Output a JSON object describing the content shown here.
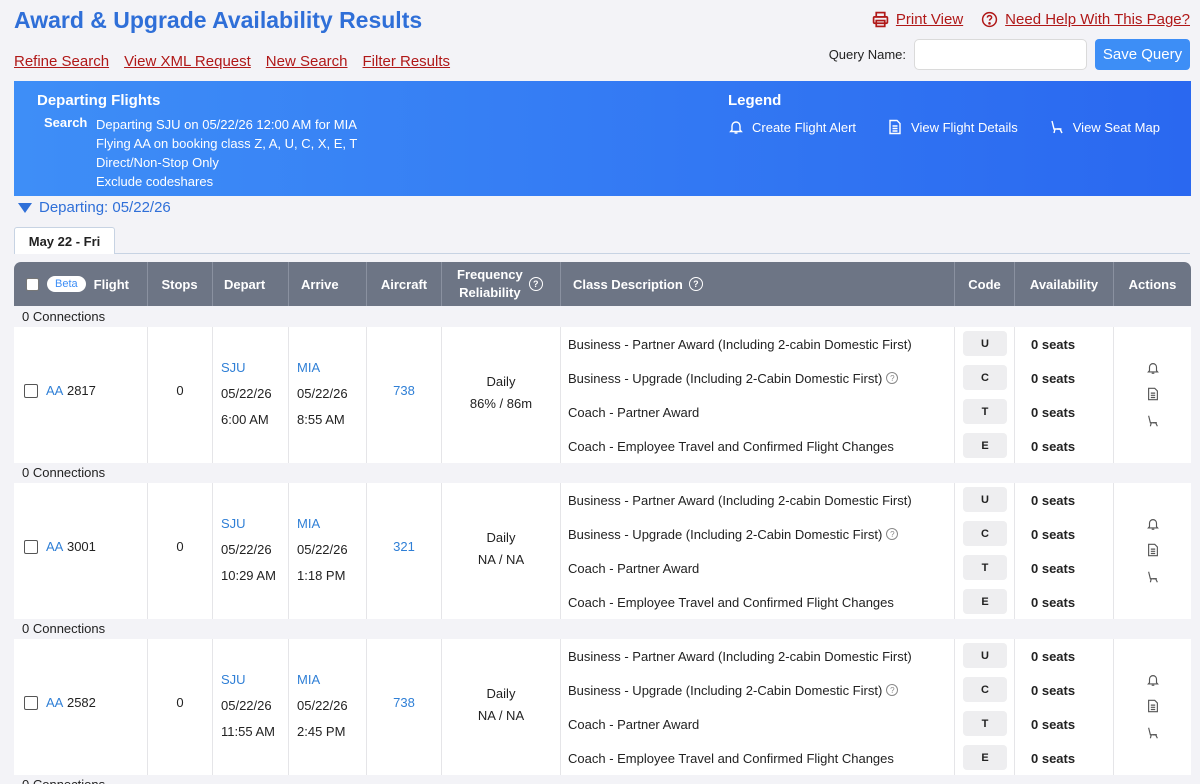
{
  "header": {
    "title": "Award & Upgrade Availability Results",
    "print_label": "Print View",
    "help_label": "Need Help With This Page?"
  },
  "nav": [
    "Refine Search",
    "View XML Request",
    "New Search",
    "Filter Results"
  ],
  "query": {
    "label": "Query Name:",
    "value": "",
    "save_label": "Save Query"
  },
  "banner": {
    "title": "Departing Flights",
    "search_label": "Search",
    "search_lines": [
      "Departing SJU on 05/22/26 12:00 AM for MIA",
      "Flying AA on booking class Z, A, U, C, X, E, T",
      "Direct/Non-Stop Only",
      "Exclude codeshares"
    ],
    "legend_title": "Legend",
    "legend": [
      "Create Flight Alert",
      "View Flight Details",
      "View Seat Map"
    ]
  },
  "departing_label": "Departing: 05/22/26",
  "tab_label": "May 22 - Fri",
  "columns": {
    "beta": "Beta",
    "flight": "Flight",
    "stops": "Stops",
    "depart": "Depart",
    "arrive": "Arrive",
    "aircraft": "Aircraft",
    "freq1": "Frequency",
    "freq2": "Reliability",
    "class_desc": "Class Description",
    "code": "Code",
    "availability": "Availability",
    "actions": "Actions"
  },
  "connections_label": "0 Connections",
  "flights": [
    {
      "carrier": "AA",
      "number": "2817",
      "stops": "0",
      "dep_airport": "SJU",
      "dep_date": "05/22/26",
      "dep_time": "6:00 AM",
      "arr_airport": "MIA",
      "arr_date": "05/22/26",
      "arr_time": "8:55 AM",
      "aircraft": "738",
      "frequency": "Daily",
      "reliability": "86% / 86m",
      "classes": [
        {
          "desc": "Business - Partner Award (Including 2-cabin Domestic First)",
          "help": false,
          "code": "U",
          "avail": "0 seats"
        },
        {
          "desc": "Business - Upgrade (Including 2-Cabin Domestic First)",
          "help": true,
          "code": "C",
          "avail": "0 seats"
        },
        {
          "desc": "Coach - Partner Award",
          "help": false,
          "code": "T",
          "avail": "0 seats"
        },
        {
          "desc": "Coach - Employee Travel and Confirmed Flight Changes",
          "help": false,
          "code": "E",
          "avail": "0 seats"
        }
      ]
    },
    {
      "carrier": "AA",
      "number": "3001",
      "stops": "0",
      "dep_airport": "SJU",
      "dep_date": "05/22/26",
      "dep_time": "10:29 AM",
      "arr_airport": "MIA",
      "arr_date": "05/22/26",
      "arr_time": "1:18 PM",
      "aircraft": "321",
      "frequency": "Daily",
      "reliability": "NA / NA",
      "classes": [
        {
          "desc": "Business - Partner Award (Including 2-cabin Domestic First)",
          "help": false,
          "code": "U",
          "avail": "0 seats"
        },
        {
          "desc": "Business - Upgrade (Including 2-Cabin Domestic First)",
          "help": true,
          "code": "C",
          "avail": "0 seats"
        },
        {
          "desc": "Coach - Partner Award",
          "help": false,
          "code": "T",
          "avail": "0 seats"
        },
        {
          "desc": "Coach - Employee Travel and Confirmed Flight Changes",
          "help": false,
          "code": "E",
          "avail": "0 seats"
        }
      ]
    },
    {
      "carrier": "AA",
      "number": "2582",
      "stops": "0",
      "dep_airport": "SJU",
      "dep_date": "05/22/26",
      "dep_time": "11:55 AM",
      "arr_airport": "MIA",
      "arr_date": "05/22/26",
      "arr_time": "2:45 PM",
      "aircraft": "738",
      "frequency": "Daily",
      "reliability": "NA / NA",
      "classes": [
        {
          "desc": "Business - Partner Award (Including 2-cabin Domestic First)",
          "help": false,
          "code": "U",
          "avail": "0 seats"
        },
        {
          "desc": "Business - Upgrade (Including 2-Cabin Domestic First)",
          "help": true,
          "code": "C",
          "avail": "0 seats"
        },
        {
          "desc": "Coach - Partner Award",
          "help": false,
          "code": "T",
          "avail": "0 seats"
        },
        {
          "desc": "Coach - Employee Travel and Confirmed Flight Changes",
          "help": false,
          "code": "E",
          "avail": "0 seats"
        }
      ]
    }
  ]
}
